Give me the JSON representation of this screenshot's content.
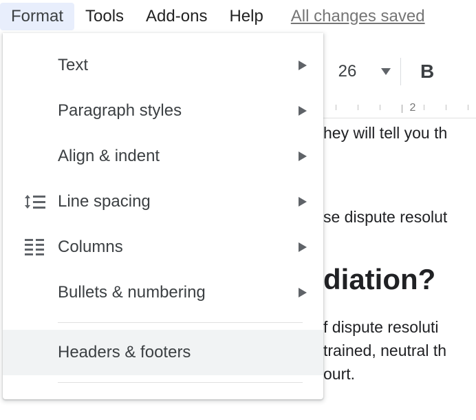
{
  "menubar": {
    "items": [
      "Format",
      "Tools",
      "Add-ons",
      "Help"
    ],
    "active_index": 0,
    "save_status": "All changes saved"
  },
  "dropdown": {
    "items": [
      {
        "icon": "",
        "label": "Text",
        "submenu": true
      },
      {
        "icon": "",
        "label": "Paragraph styles",
        "submenu": true
      },
      {
        "icon": "",
        "label": "Align & indent",
        "submenu": true
      },
      {
        "icon": "line-spacing",
        "label": "Line spacing",
        "submenu": true
      },
      {
        "icon": "columns",
        "label": "Columns",
        "submenu": true
      },
      {
        "icon": "",
        "label": "Bullets & numbering",
        "submenu": true
      }
    ],
    "separator_after": 5,
    "hover_item": {
      "label": "Headers & footers"
    }
  },
  "toolbar": {
    "font_size": "26",
    "bold_label": "B"
  },
  "ruler": {
    "major_value": "2"
  },
  "document": {
    "line1": "hey will tell you th",
    "line2": "se dispute resolut",
    "heading": "diation?",
    "line3": "f dispute resoluti",
    "line4": "trained, neutral th",
    "line5": "ourt."
  },
  "colors": {
    "menu_active_bg": "#e8eefc",
    "text_primary": "#3c4043",
    "text_secondary": "#757575",
    "hover_bg": "#f1f3f4"
  }
}
